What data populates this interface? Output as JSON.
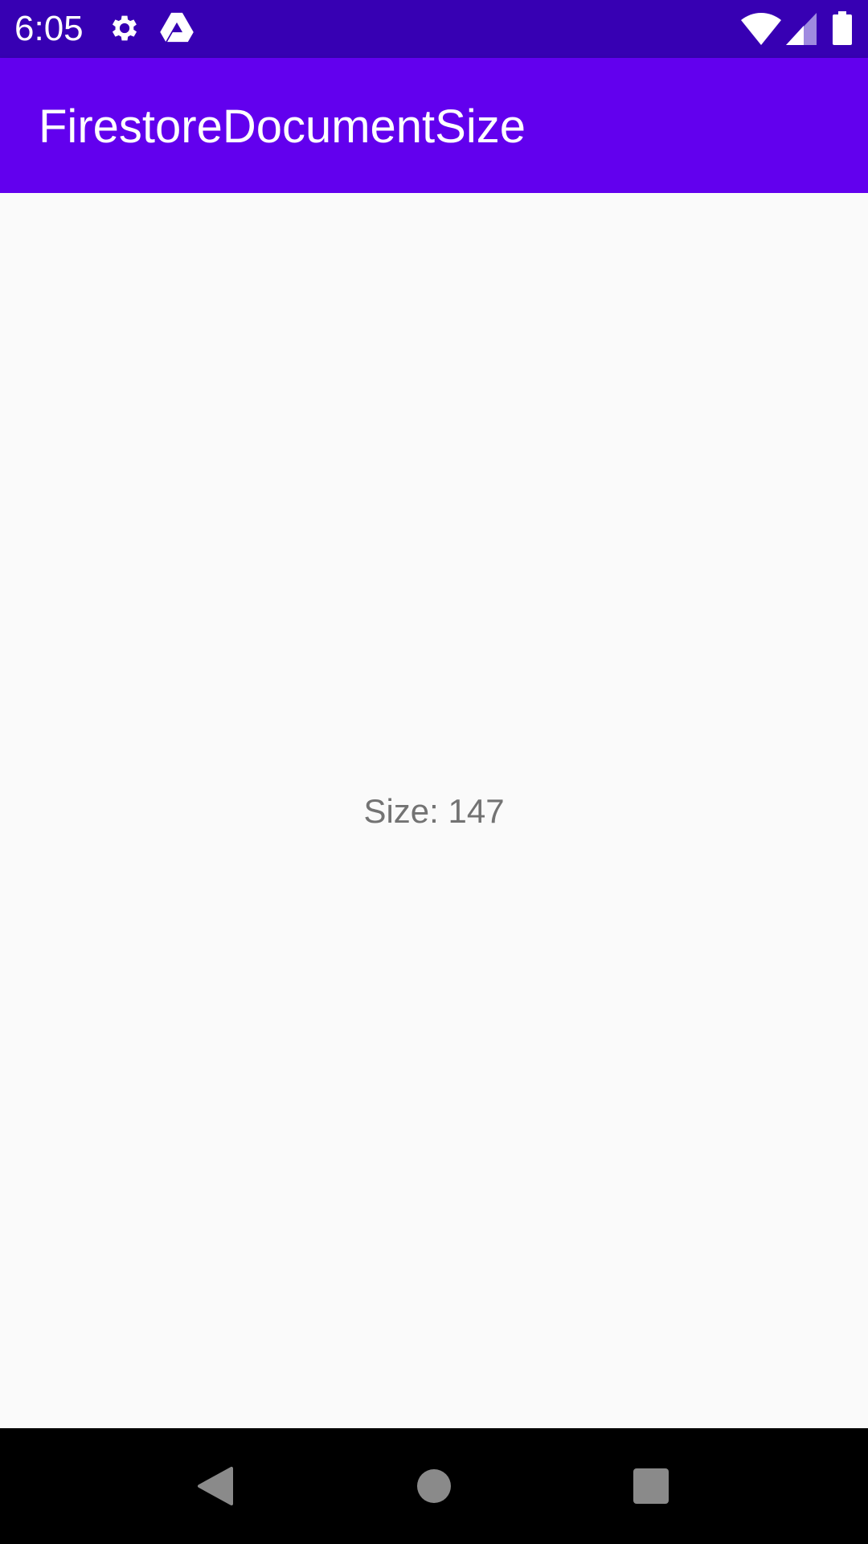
{
  "status_bar": {
    "time": "6:05",
    "background": "#3700b3",
    "left_icons": [
      "gear-icon",
      "drive-icon"
    ],
    "right_icons": [
      "wifi-icon",
      "cell-signal-icon",
      "battery-icon"
    ]
  },
  "app_bar": {
    "title": "FirestoreDocumentSize",
    "background": "#6200ee"
  },
  "main": {
    "size_text": "Size: 147",
    "text_color": "#737373",
    "background": "#fafafa"
  },
  "nav_bar": {
    "background": "#000000",
    "buttons": [
      "back-icon",
      "home-icon",
      "recents-icon"
    ],
    "icon_color": "#8a8a8a"
  }
}
